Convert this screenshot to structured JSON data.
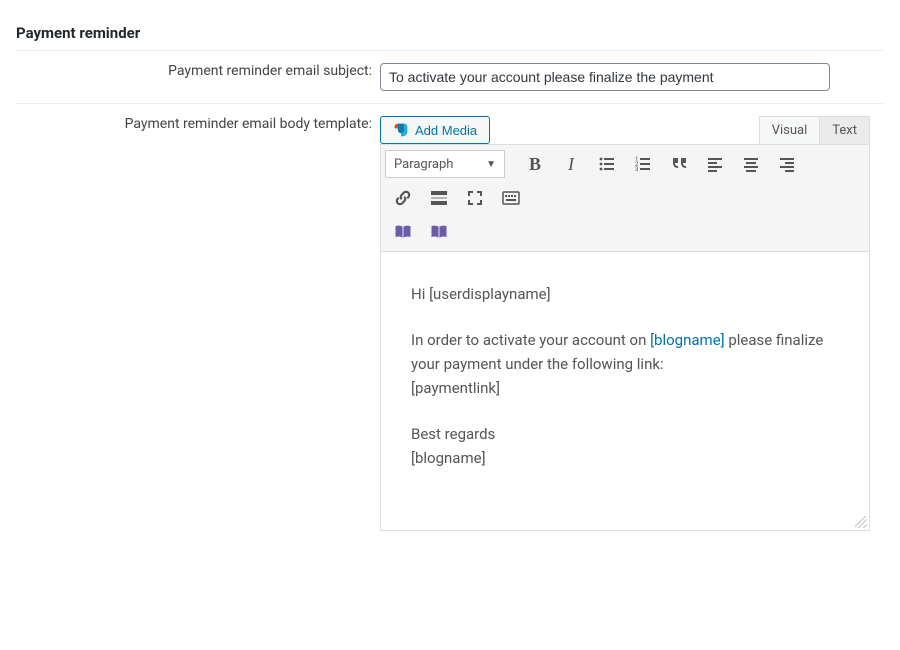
{
  "section": {
    "title": "Payment reminder"
  },
  "subject": {
    "label": "Payment reminder email subject:",
    "value": "To activate your account please finalize the payment"
  },
  "body": {
    "label": "Payment reminder email body template:",
    "add_media": "Add Media",
    "tabs": {
      "visual": "Visual",
      "text": "Text"
    },
    "format": "Paragraph",
    "content": {
      "p1_pre": "Hi ",
      "p1_token": "[userdisplayname]",
      "p2_pre": "In order to activate your account on ",
      "p2_link": "[blogname]",
      "p2_post1": " please finalize your payment under the following link: ",
      "p2_token": "[paymentlink]",
      "p3_line1": "Best regards",
      "p3_line2": "[blogname]"
    }
  }
}
